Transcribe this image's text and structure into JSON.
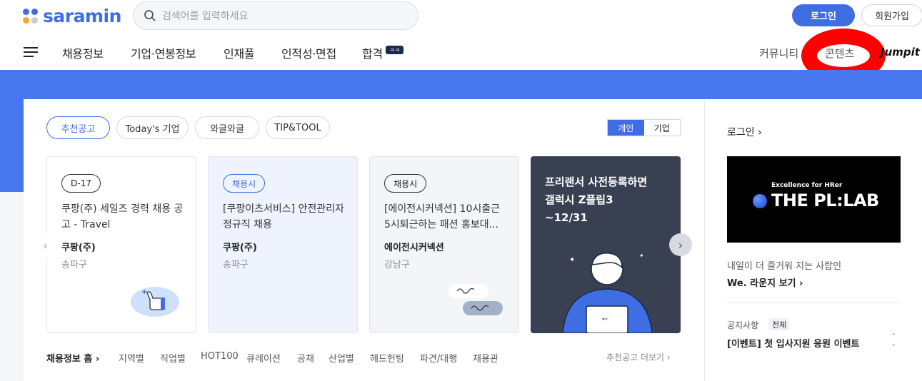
{
  "header": {
    "logo_text": "saramin",
    "search_placeholder": "검색어를 입력하세요",
    "login": "로그인",
    "join": "회원가입"
  },
  "gnb": [
    "채용정보",
    "기업·연봉정보",
    "인재풀",
    "인적성·면접",
    "합격"
  ],
  "gnb_badge": "ㅋㅋ",
  "right_nav": {
    "community": "커뮤니티",
    "contents": "콘텐츠",
    "jumpit": "Jumpit"
  },
  "tabs": [
    "추천공고",
    "Today's 기업",
    "와글와글",
    "TIP&TOOL"
  ],
  "segment": [
    "개인",
    "기업"
  ],
  "cards": [
    {
      "chip": "D-17",
      "title": "쿠팡(주) 세일즈 경력 채용 공고 - Travel",
      "company": "쿠팡(주)",
      "location": "송파구"
    },
    {
      "chip": "채용시",
      "title": "[쿠팡이츠서비스] 안전관리자 정규직 채용",
      "company": "쿠팡(주)",
      "location": "송파구"
    },
    {
      "chip": "채용시",
      "title": "[에이전시커넥션] 10시출근 5시퇴근하는 패션 홍보대...",
      "company": "에이전시커넥션",
      "location": "강남구"
    }
  ],
  "promo": {
    "line1": "프리랜서 사전등록하면",
    "line2": "갤럭시 Z플립3",
    "line3": "~12/31"
  },
  "footer": {
    "home": "채용정보 홈 ›",
    "links": [
      "지역별",
      "직업별",
      "HOT100",
      "큐레이션",
      "공채",
      "산업별",
      "헤드헌팅",
      "파견/대행",
      "채용관"
    ],
    "more": "추천공고 더보기 ›"
  },
  "side": {
    "login": "로그인 ›",
    "ad_small": "Excellence for HRer",
    "ad_big": "THE PL:LAB",
    "lounge_desc": "내일이 더 즐거워 지는 사람인",
    "lounge_link": "We. 라운지 보기 ›",
    "notice_label": "공지사항",
    "notice_tag": "전체",
    "notice_text": "[이벤트] 첫 입사지원 응원 이벤트"
  },
  "colors": {
    "brand": "#3f6de3",
    "banner": "#4876ef"
  }
}
